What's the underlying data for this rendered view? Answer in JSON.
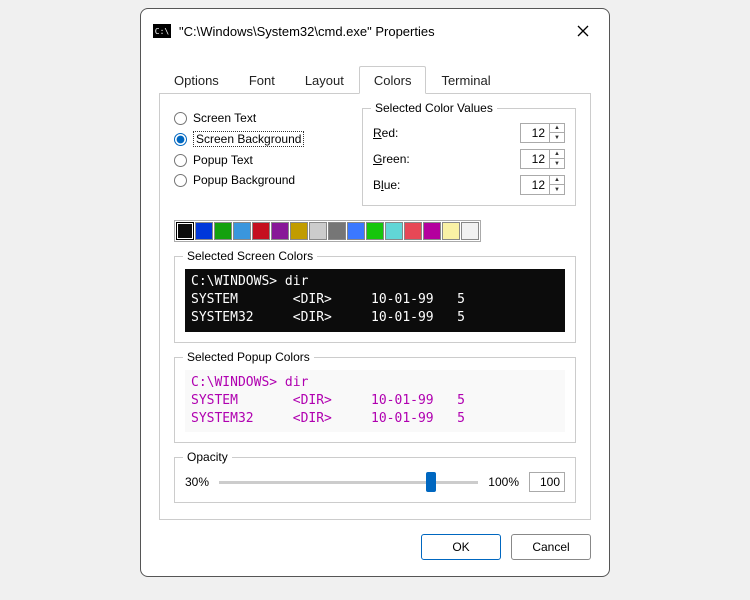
{
  "window": {
    "title": "\"C:\\Windows\\System32\\cmd.exe\" Properties",
    "icon_label": "C:\\"
  },
  "tabs": [
    "Options",
    "Font",
    "Layout",
    "Colors",
    "Terminal"
  ],
  "active_tab": "Colors",
  "radios": {
    "screen_text": "Screen Text",
    "screen_background": "Screen Background",
    "popup_text": "Popup Text",
    "popup_background": "Popup Background",
    "selected": "screen_background"
  },
  "scv": {
    "title": "Selected Color Values",
    "red_label": "Red:",
    "green_label": "Green:",
    "blue_label": "Blue:",
    "red": "12",
    "green": "12",
    "blue": "12"
  },
  "palette": [
    "#0c0c0c",
    "#0037da",
    "#13a10e",
    "#3a96dd",
    "#c50f1f",
    "#881798",
    "#c19c00",
    "#cccccc",
    "#767676",
    "#3b78ff",
    "#16c60c",
    "#61d6d6",
    "#e74856",
    "#b4009e",
    "#f9f1a5",
    "#f2f2f2"
  ],
  "palette_selected": 0,
  "screen_section": {
    "title": "Selected Screen Colors",
    "preview": "C:\\WINDOWS> dir\nSYSTEM       <DIR>     10-01-99   5\nSYSTEM32     <DIR>     10-01-99   5"
  },
  "popup_section": {
    "title": "Selected Popup Colors",
    "preview": "C:\\WINDOWS> dir\nSYSTEM       <DIR>     10-01-99   5\nSYSTEM32     <DIR>     10-01-99   5"
  },
  "opacity": {
    "label": "Opacity",
    "min_label": "30%",
    "max_label": "100%",
    "value": "100",
    "slider_value": "88"
  },
  "buttons": {
    "ok": "OK",
    "cancel": "Cancel"
  }
}
